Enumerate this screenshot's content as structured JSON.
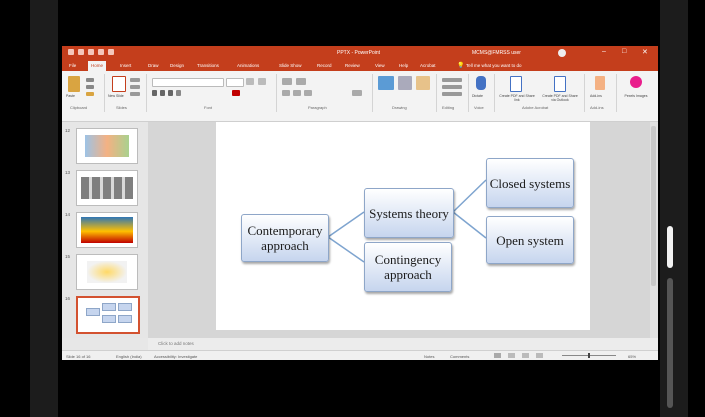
{
  "app": {
    "title": "PPTX - PowerPoint",
    "user": "MCMS@FMRSS user",
    "window_controls": [
      "–",
      "□",
      "✕"
    ]
  },
  "ribbon_tabs": [
    "File",
    "Home",
    "Insert",
    "Draw",
    "Design",
    "Transitions",
    "Animations",
    "Slide Show",
    "Record",
    "Review",
    "View",
    "Help",
    "Acrobat",
    "Tell me what you want to do"
  ],
  "active_tab": "Home",
  "ribbon_groups": [
    "Clipboard",
    "Slides",
    "Font",
    "Paragraph",
    "Drawing",
    "Editing",
    "Adobe Acrobat",
    "Add-ins",
    "Voice"
  ],
  "ribbon_buttons": {
    "paste": "Paste",
    "new_slide": "New Slide",
    "dictate": "Dictate",
    "designer": "Designer",
    "create_pdf": "Create PDF and Share link",
    "create_pdf_outlook": "Create PDF and Share via Outlook",
    "addins": "Add-ins",
    "pexels": "Pexels Images"
  },
  "thumbnails": [
    {
      "number": "12",
      "selected": false
    },
    {
      "number": "13",
      "selected": false
    },
    {
      "number": "14",
      "selected": false
    },
    {
      "number": "15",
      "selected": false
    },
    {
      "number": "16",
      "selected": true
    }
  ],
  "slide": {
    "boxes": {
      "contemporary": "Contemporary approach",
      "systems": "Systems theory",
      "contingency": "Contingency approach",
      "closed": "Closed systems",
      "open": "Open system"
    }
  },
  "notes_placeholder": "Click to add notes",
  "status": {
    "slide_info": "Slide 16 of 16",
    "language": "English (India)",
    "accessibility": "Accessibility: Investigate",
    "notes": "Notes",
    "comments": "Comments",
    "zoom": "65%"
  },
  "colors": {
    "accent": "#c43e1c",
    "box_border": "#8ea6c8",
    "box_fill_top": "#ffffff",
    "box_fill_bottom": "#c6d5ee",
    "connector": "#7ea4cf"
  }
}
